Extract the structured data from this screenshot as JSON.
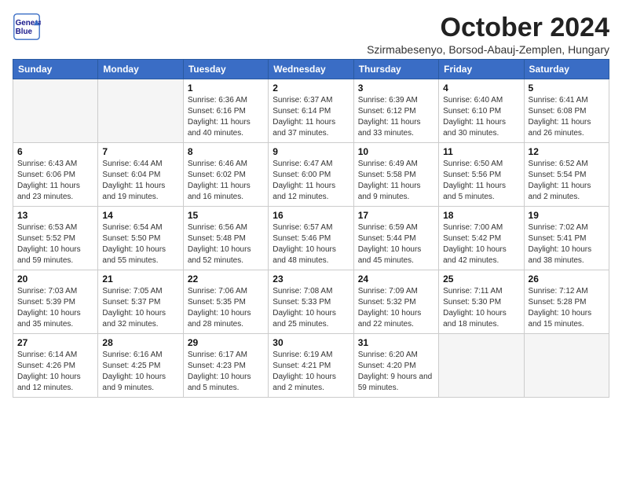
{
  "header": {
    "logo_line1": "General",
    "logo_line2": "Blue",
    "month_title": "October 2024",
    "subtitle": "Szirmabesenyo, Borsod-Abauj-Zemplen, Hungary"
  },
  "weekdays": [
    "Sunday",
    "Monday",
    "Tuesday",
    "Wednesday",
    "Thursday",
    "Friday",
    "Saturday"
  ],
  "weeks": [
    [
      {
        "day": "",
        "info": ""
      },
      {
        "day": "",
        "info": ""
      },
      {
        "day": "1",
        "info": "Sunrise: 6:36 AM\nSunset: 6:16 PM\nDaylight: 11 hours and 40 minutes."
      },
      {
        "day": "2",
        "info": "Sunrise: 6:37 AM\nSunset: 6:14 PM\nDaylight: 11 hours and 37 minutes."
      },
      {
        "day": "3",
        "info": "Sunrise: 6:39 AM\nSunset: 6:12 PM\nDaylight: 11 hours and 33 minutes."
      },
      {
        "day": "4",
        "info": "Sunrise: 6:40 AM\nSunset: 6:10 PM\nDaylight: 11 hours and 30 minutes."
      },
      {
        "day": "5",
        "info": "Sunrise: 6:41 AM\nSunset: 6:08 PM\nDaylight: 11 hours and 26 minutes."
      }
    ],
    [
      {
        "day": "6",
        "info": "Sunrise: 6:43 AM\nSunset: 6:06 PM\nDaylight: 11 hours and 23 minutes."
      },
      {
        "day": "7",
        "info": "Sunrise: 6:44 AM\nSunset: 6:04 PM\nDaylight: 11 hours and 19 minutes."
      },
      {
        "day": "8",
        "info": "Sunrise: 6:46 AM\nSunset: 6:02 PM\nDaylight: 11 hours and 16 minutes."
      },
      {
        "day": "9",
        "info": "Sunrise: 6:47 AM\nSunset: 6:00 PM\nDaylight: 11 hours and 12 minutes."
      },
      {
        "day": "10",
        "info": "Sunrise: 6:49 AM\nSunset: 5:58 PM\nDaylight: 11 hours and 9 minutes."
      },
      {
        "day": "11",
        "info": "Sunrise: 6:50 AM\nSunset: 5:56 PM\nDaylight: 11 hours and 5 minutes."
      },
      {
        "day": "12",
        "info": "Sunrise: 6:52 AM\nSunset: 5:54 PM\nDaylight: 11 hours and 2 minutes."
      }
    ],
    [
      {
        "day": "13",
        "info": "Sunrise: 6:53 AM\nSunset: 5:52 PM\nDaylight: 10 hours and 59 minutes."
      },
      {
        "day": "14",
        "info": "Sunrise: 6:54 AM\nSunset: 5:50 PM\nDaylight: 10 hours and 55 minutes."
      },
      {
        "day": "15",
        "info": "Sunrise: 6:56 AM\nSunset: 5:48 PM\nDaylight: 10 hours and 52 minutes."
      },
      {
        "day": "16",
        "info": "Sunrise: 6:57 AM\nSunset: 5:46 PM\nDaylight: 10 hours and 48 minutes."
      },
      {
        "day": "17",
        "info": "Sunrise: 6:59 AM\nSunset: 5:44 PM\nDaylight: 10 hours and 45 minutes."
      },
      {
        "day": "18",
        "info": "Sunrise: 7:00 AM\nSunset: 5:42 PM\nDaylight: 10 hours and 42 minutes."
      },
      {
        "day": "19",
        "info": "Sunrise: 7:02 AM\nSunset: 5:41 PM\nDaylight: 10 hours and 38 minutes."
      }
    ],
    [
      {
        "day": "20",
        "info": "Sunrise: 7:03 AM\nSunset: 5:39 PM\nDaylight: 10 hours and 35 minutes."
      },
      {
        "day": "21",
        "info": "Sunrise: 7:05 AM\nSunset: 5:37 PM\nDaylight: 10 hours and 32 minutes."
      },
      {
        "day": "22",
        "info": "Sunrise: 7:06 AM\nSunset: 5:35 PM\nDaylight: 10 hours and 28 minutes."
      },
      {
        "day": "23",
        "info": "Sunrise: 7:08 AM\nSunset: 5:33 PM\nDaylight: 10 hours and 25 minutes."
      },
      {
        "day": "24",
        "info": "Sunrise: 7:09 AM\nSunset: 5:32 PM\nDaylight: 10 hours and 22 minutes."
      },
      {
        "day": "25",
        "info": "Sunrise: 7:11 AM\nSunset: 5:30 PM\nDaylight: 10 hours and 18 minutes."
      },
      {
        "day": "26",
        "info": "Sunrise: 7:12 AM\nSunset: 5:28 PM\nDaylight: 10 hours and 15 minutes."
      }
    ],
    [
      {
        "day": "27",
        "info": "Sunrise: 6:14 AM\nSunset: 4:26 PM\nDaylight: 10 hours and 12 minutes."
      },
      {
        "day": "28",
        "info": "Sunrise: 6:16 AM\nSunset: 4:25 PM\nDaylight: 10 hours and 9 minutes."
      },
      {
        "day": "29",
        "info": "Sunrise: 6:17 AM\nSunset: 4:23 PM\nDaylight: 10 hours and 5 minutes."
      },
      {
        "day": "30",
        "info": "Sunrise: 6:19 AM\nSunset: 4:21 PM\nDaylight: 10 hours and 2 minutes."
      },
      {
        "day": "31",
        "info": "Sunrise: 6:20 AM\nSunset: 4:20 PM\nDaylight: 9 hours and 59 minutes."
      },
      {
        "day": "",
        "info": ""
      },
      {
        "day": "",
        "info": ""
      }
    ]
  ]
}
